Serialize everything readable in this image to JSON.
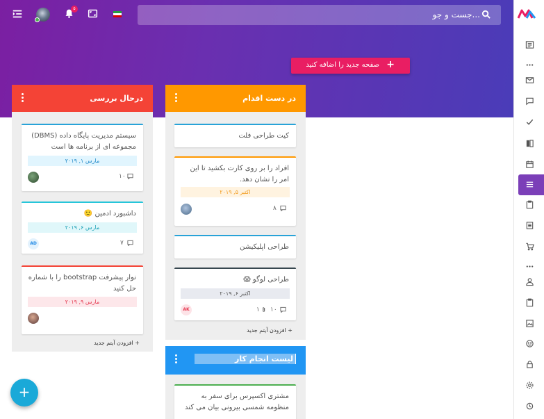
{
  "topbar": {
    "search_placeholder": "جست و جو...",
    "notification_count": "۵"
  },
  "add_page_button": "صفحه جدید را اضافه کنید",
  "add_item_label": "+ افزودن آیتم جدید",
  "columns": [
    {
      "title": "درحال بررسی",
      "color": "#f44336",
      "cards": [
        {
          "text": "سیستم مدیریت پایگاه داده (DBMS) مجموعه ای از برنامه ها است",
          "date": "مارس ۱, ۲۰۱۹",
          "date_bg": "#e1f5fe",
          "date_color": "#1e88c8",
          "accent": "#29a3d8",
          "comments": "۱۰",
          "avatar": "photo"
        },
        {
          "text": "داشبورد ادمین 🙂",
          "date": "مارس ۶, ۲۰۱۹",
          "date_bg": "#e0f7fa",
          "date_color": "#1a9fb5",
          "accent": "#26c6da",
          "comments": "۷",
          "avatar": "AD"
        },
        {
          "text": "نوار پیشرفت bootstrap را با شماره حل کنید",
          "date": "مارس ۹, ۲۰۱۹",
          "date_bg": "#fde7ea",
          "date_color": "#e53950",
          "accent": "#f44336",
          "comments": "",
          "avatar": "photo"
        }
      ]
    },
    {
      "title": "در دست اقدام",
      "color": "#ff9800",
      "cards": [
        {
          "text": "کیت طراحی فلت",
          "accent": "#29a3d8"
        },
        {
          "text": "افراد را بر روی کارت بکشید تا این امر را نشان دهد.",
          "date": "اکتبر ۵, ۲۰۱۹",
          "date_bg": "#fff3e0",
          "date_color": "#f29a1a",
          "accent": "#ff9800",
          "comments": "۸",
          "avatar": "photo"
        },
        {
          "text": "طراحی اپلیکیشن",
          "accent": "#29a3d8"
        },
        {
          "text": "طراحی لوگو 😱",
          "date": "اکتبر ۶, ۲۰۱۹",
          "date_bg": "#e8eaf0",
          "date_color": "#555",
          "accent": "#37474f",
          "comments": "۱۰",
          "attachments": "۱",
          "avatar": "AK"
        }
      ]
    },
    {
      "title": "لیست انجام کار",
      "color": "#2196f3",
      "cards": [
        {
          "text": "مشتری اکسپرس برای سفر به منظومه شمسی بیرونی بیان می کند",
          "accent": "#4caf50"
        }
      ]
    }
  ],
  "colors": {
    "accent": "#7b3fb8",
    "fab": "#1aa9d8",
    "pink": "#e91e63"
  }
}
